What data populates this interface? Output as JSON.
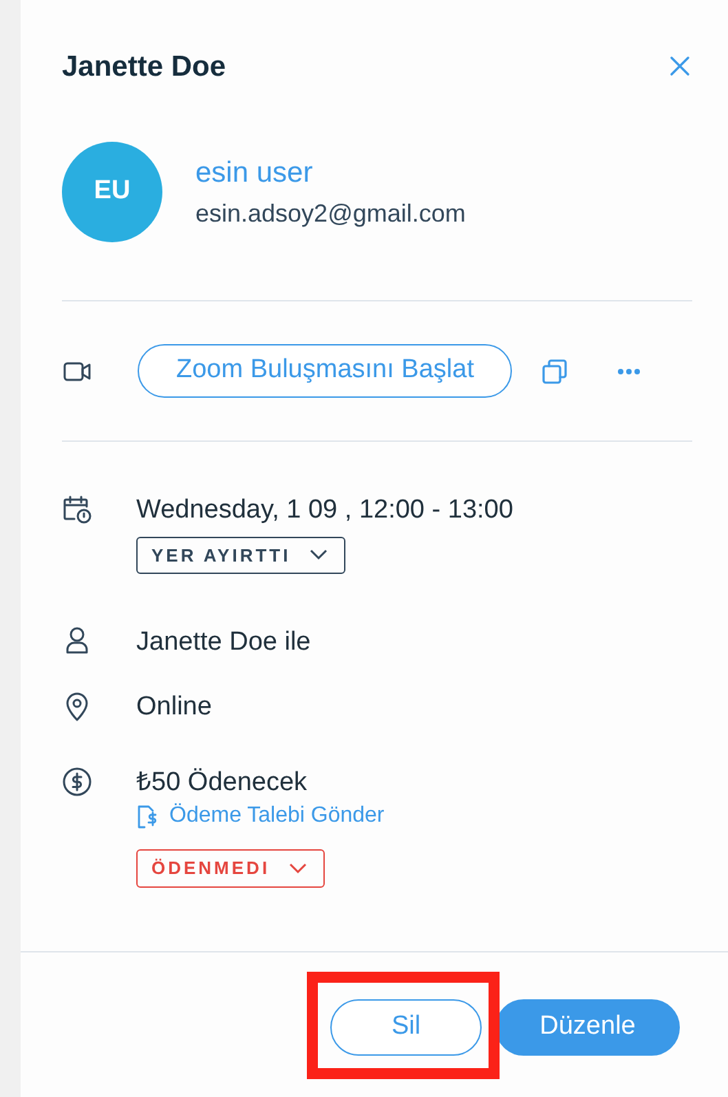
{
  "panel": {
    "title": "Janette Doe"
  },
  "customer": {
    "initials": "EU",
    "name": "esin user",
    "email": "esin.adsoy2@gmail.com"
  },
  "meeting": {
    "button": "Zoom Buluşmasını Başlat"
  },
  "details": [
    {
      "kind": "datetime",
      "text": "Wednesday, 1 09 , 12:00 - 13:00",
      "status": {
        "label": "YER AYIRTTI",
        "color": "#32475a"
      }
    },
    {
      "kind": "person",
      "text": "Janette Doe ile"
    },
    {
      "kind": "location",
      "text": "Online"
    },
    {
      "kind": "payment",
      "text": "₺50 Ödenecek",
      "link": "Ödeme Talebi Gönder",
      "status": {
        "label": "ÖDENMEDI",
        "color": "#e5463f"
      }
    }
  ],
  "footer": [
    {
      "label": "Sil",
      "kind": "outline",
      "highlighted": true
    },
    {
      "label": "Düzenle",
      "kind": "primary",
      "highlighted": false
    }
  ]
}
